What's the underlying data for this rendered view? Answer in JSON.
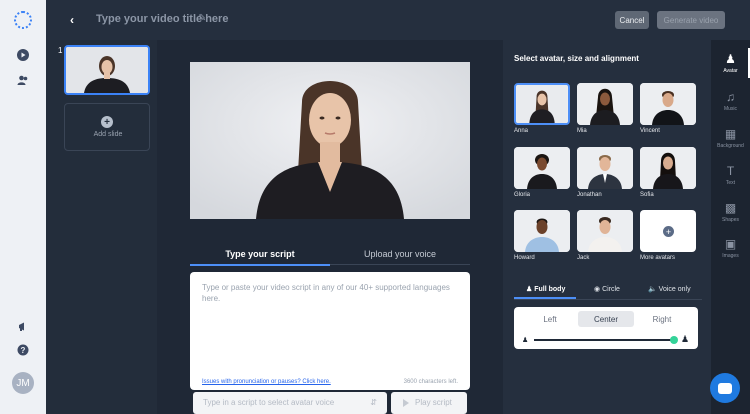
{
  "header": {
    "back_icon": "chevron-left-icon",
    "title_placeholder": "Type your video title here",
    "edit_icon": "pencil-icon",
    "cancel_label": "Cancel",
    "generate_label": "Generate video"
  },
  "rail": {
    "logo_icon": "dotted-circle-logo-icon",
    "items": [
      "play-icon",
      "people-icon"
    ],
    "bottom": [
      "megaphone-icon",
      "help-icon"
    ],
    "user_initials": "JM"
  },
  "slides": {
    "items": [
      {
        "number": "1"
      }
    ],
    "add_label": "Add slide"
  },
  "editor": {
    "tabs": [
      {
        "label": "Type your script",
        "active": true
      },
      {
        "label": "Upload your voice",
        "active": false
      }
    ],
    "script_placeholder": "Type or paste your video script in any of our 40+ supported languages here.",
    "pronunciation_link": "Issues with pronunciation or pauses? Click here.",
    "chars_left": "3600 characters left.",
    "voice_select_placeholder": "Type in a script to select avatar voice",
    "play_label": "Play script"
  },
  "avatar_panel": {
    "heading": "Select avatar, size and alignment",
    "avatars": [
      {
        "name": "Anna",
        "selected": true
      },
      {
        "name": "Mia"
      },
      {
        "name": "Vincent"
      },
      {
        "name": "Gloria"
      },
      {
        "name": "Jonathan"
      },
      {
        "name": "Sofia"
      },
      {
        "name": "Howard"
      },
      {
        "name": "Jack"
      },
      {
        "name": "More avatars"
      }
    ],
    "shape_tabs": [
      {
        "label": "Full body",
        "active": true
      },
      {
        "label": "Circle"
      },
      {
        "label": "Voice only"
      }
    ],
    "alignment": [
      {
        "label": "Left"
      },
      {
        "label": "Center",
        "selected": true
      },
      {
        "label": "Right"
      }
    ],
    "size_slider_level": 1.0
  },
  "iconbar": [
    {
      "label": "Avatar",
      "active": true
    },
    {
      "label": "Music"
    },
    {
      "label": "Background"
    },
    {
      "label": "Text"
    },
    {
      "label": "Shapes"
    },
    {
      "label": "Images"
    }
  ],
  "colors": {
    "accent": "#4d8ff7",
    "background": "#252f3e",
    "slider_knob": "#34d399",
    "chat_button": "#1f7ae0"
  }
}
